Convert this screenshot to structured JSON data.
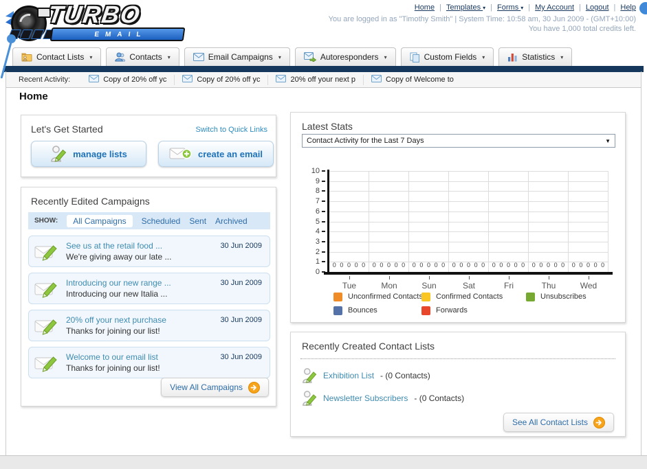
{
  "header": {
    "logo": {
      "title": "TURBO",
      "subtitle": "EMAIL"
    },
    "nav_links": [
      {
        "label": "Home",
        "dropdown": false
      },
      {
        "label": "Templates",
        "dropdown": true
      },
      {
        "label": "Forms",
        "dropdown": true
      },
      {
        "label": "My Account",
        "dropdown": false
      },
      {
        "label": "Logout",
        "dropdown": false
      },
      {
        "label": "Help",
        "dropdown": false
      }
    ],
    "status_line1": "You are logged in as \"Timothy Smith\" | System Time: 10:58 am, 30 Jun 2009 - (GMT+10:00)",
    "status_line2": "You have 1,000 total credits left."
  },
  "nav_tabs": [
    {
      "label": "Contact Lists",
      "icon": "contact-lists-icon"
    },
    {
      "label": "Contacts",
      "icon": "contacts-icon"
    },
    {
      "label": "Email Campaigns",
      "icon": "email-campaigns-icon"
    },
    {
      "label": "Autoresponders",
      "icon": "autoresponders-icon"
    },
    {
      "label": "Custom Fields",
      "icon": "custom-fields-icon"
    },
    {
      "label": "Statistics",
      "icon": "statistics-icon"
    }
  ],
  "recent_activity": {
    "label": "Recent Activity:",
    "items": [
      "Copy of 20% off yc",
      "Copy of 20% off yc",
      "20% off your next p",
      "Copy of Welcome to"
    ]
  },
  "page_title": "Home",
  "get_started": {
    "title": "Let's Get Started",
    "switch_link": "Switch to Quick Links",
    "buttons": [
      {
        "label": "manage lists",
        "icon": "manage-lists-icon"
      },
      {
        "label": "create an email",
        "icon": "create-email-icon"
      }
    ]
  },
  "campaigns": {
    "title": "Recently Edited Campaigns",
    "show_label": "SHOW:",
    "filters": [
      {
        "label": "All Campaigns",
        "active": true
      },
      {
        "label": "Scheduled",
        "active": false
      },
      {
        "label": "Sent",
        "active": false
      },
      {
        "label": "Archived",
        "active": false
      }
    ],
    "items": [
      {
        "title": "See us at the retail food ...",
        "subtitle": "We're giving away our late ...",
        "date": "30 Jun 2009"
      },
      {
        "title": "Introducing our new range ...",
        "subtitle": "Introducing our new Italia ...",
        "date": "30 Jun 2009"
      },
      {
        "title": "20% off your next purchase",
        "subtitle": "Thanks for joining our list!",
        "date": "30 Jun 2009"
      },
      {
        "title": "Welcome to our email list",
        "subtitle": "Thanks for joining our list!",
        "date": "30 Jun 2009"
      }
    ],
    "view_all_label": "View All Campaigns"
  },
  "latest_stats": {
    "title": "Latest Stats",
    "selected_option": "Contact Activity for the Last 7 Days"
  },
  "chart_data": {
    "type": "bar",
    "title": "Contact Activity for the Last 7 Days",
    "categories": [
      "Tue",
      "Mon",
      "Sun",
      "Sat",
      "Fri",
      "Thu",
      "Wed"
    ],
    "series": [
      {
        "name": "Unconfirmed Contacts",
        "color": "#F08C28",
        "values": [
          0,
          0,
          0,
          0,
          0,
          0,
          0
        ]
      },
      {
        "name": "Confirmed Contacts",
        "color": "#F9C623",
        "values": [
          0,
          0,
          0,
          0,
          0,
          0,
          0
        ]
      },
      {
        "name": "Unsubscribes",
        "color": "#76A832",
        "values": [
          0,
          0,
          0,
          0,
          0,
          0,
          0
        ]
      },
      {
        "name": "Bounces",
        "color": "#5572A8",
        "values": [
          0,
          0,
          0,
          0,
          0,
          0,
          0
        ]
      },
      {
        "name": "Forwards",
        "color": "#E8472B",
        "values": [
          0,
          0,
          0,
          0,
          0,
          0,
          0
        ]
      }
    ],
    "ylim": [
      0,
      10
    ],
    "ytick_step": 1,
    "grid": true,
    "legend_position": "bottom",
    "data_labels": true
  },
  "contact_lists": {
    "title": "Recently Created Contact Lists",
    "items": [
      {
        "name": "Exhibition List",
        "detail": "- (0 Contacts)"
      },
      {
        "name": "Newsletter Subscribers",
        "detail": "- (0 Contacts)"
      }
    ],
    "see_all_label": "See All Contact Lists"
  }
}
